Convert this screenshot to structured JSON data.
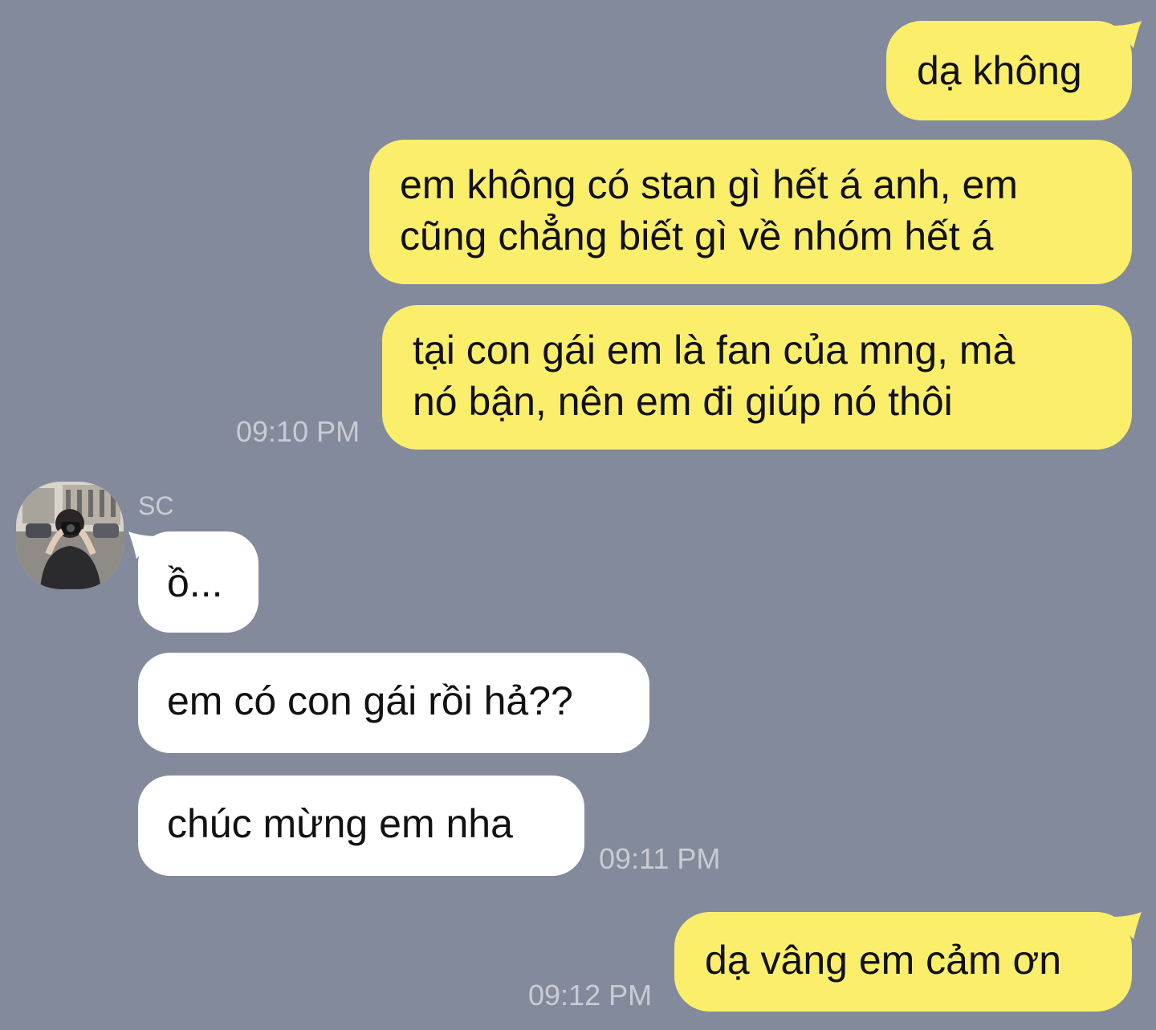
{
  "chat": {
    "colors": {
      "background": "#838a9b",
      "outgoing_bubble": "#fbee6b",
      "incoming_bubble": "#ffffff",
      "timestamp": "#c9ccd3"
    },
    "messages": [
      {
        "direction": "outgoing",
        "text": "dạ không"
      },
      {
        "direction": "outgoing",
        "lines": [
          "em không có stan gì hết á anh, em",
          "cũng chẳng biết gì về nhóm hết á"
        ]
      },
      {
        "direction": "outgoing",
        "lines": [
          "tại con gái em là fan của mng, mà",
          "nó bận, nên em đi giúp nó thôi"
        ],
        "time": "09:10 PM"
      },
      {
        "direction": "incoming",
        "sender": "SC",
        "avatar": "avatar-photo",
        "text": "ồ..."
      },
      {
        "direction": "incoming",
        "text": "em có con gái rồi hả??"
      },
      {
        "direction": "incoming",
        "text": "chúc mừng em nha",
        "time": "09:11 PM"
      },
      {
        "direction": "outgoing",
        "text": "dạ vâng em cảm ơn",
        "time": "09:12 PM"
      }
    ]
  }
}
